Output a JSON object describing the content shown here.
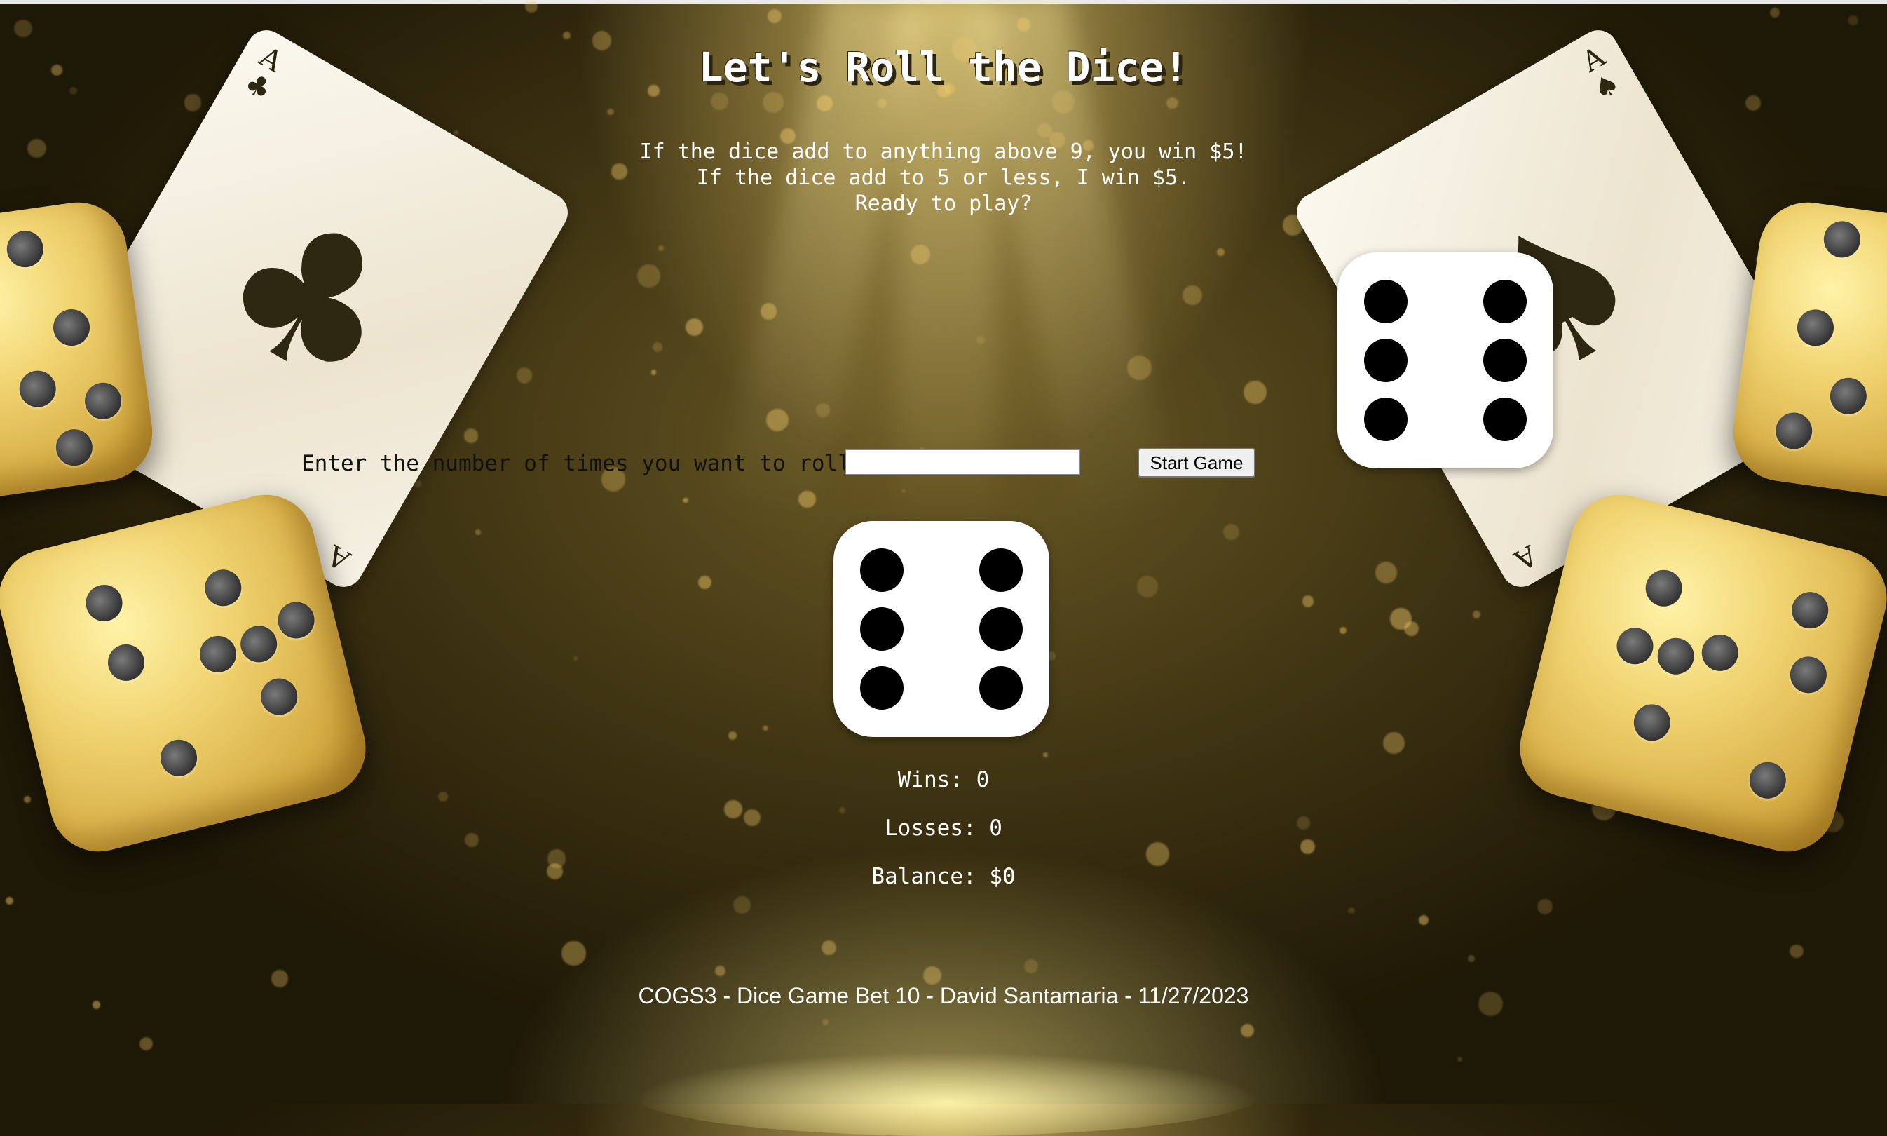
{
  "title": "Let's Roll the Dice!",
  "rules": [
    "If the dice add to anything above 9, you win $5!",
    "If the dice add to 5 or less, I win $5.",
    "Ready to play?"
  ],
  "roll_form": {
    "label": "Enter the number of times you want to roll:",
    "input_value": "",
    "button_label": "Start Game"
  },
  "dice": {
    "die1_value": 6,
    "die2_value": 6
  },
  "stats": {
    "wins": "Wins: 0",
    "losses": "Losses: 0",
    "balance": "Balance: $0"
  },
  "footer": "COGS3 - Dice Game Bet 10 - David Santamaria - 11/27/2023",
  "decor": {
    "left_card_rank": "A",
    "left_card_suit": "♣",
    "right_card_rank": "A",
    "right_card_suit": "♠",
    "background_color": "#3e3312",
    "accent_gold": "#f1d472"
  }
}
